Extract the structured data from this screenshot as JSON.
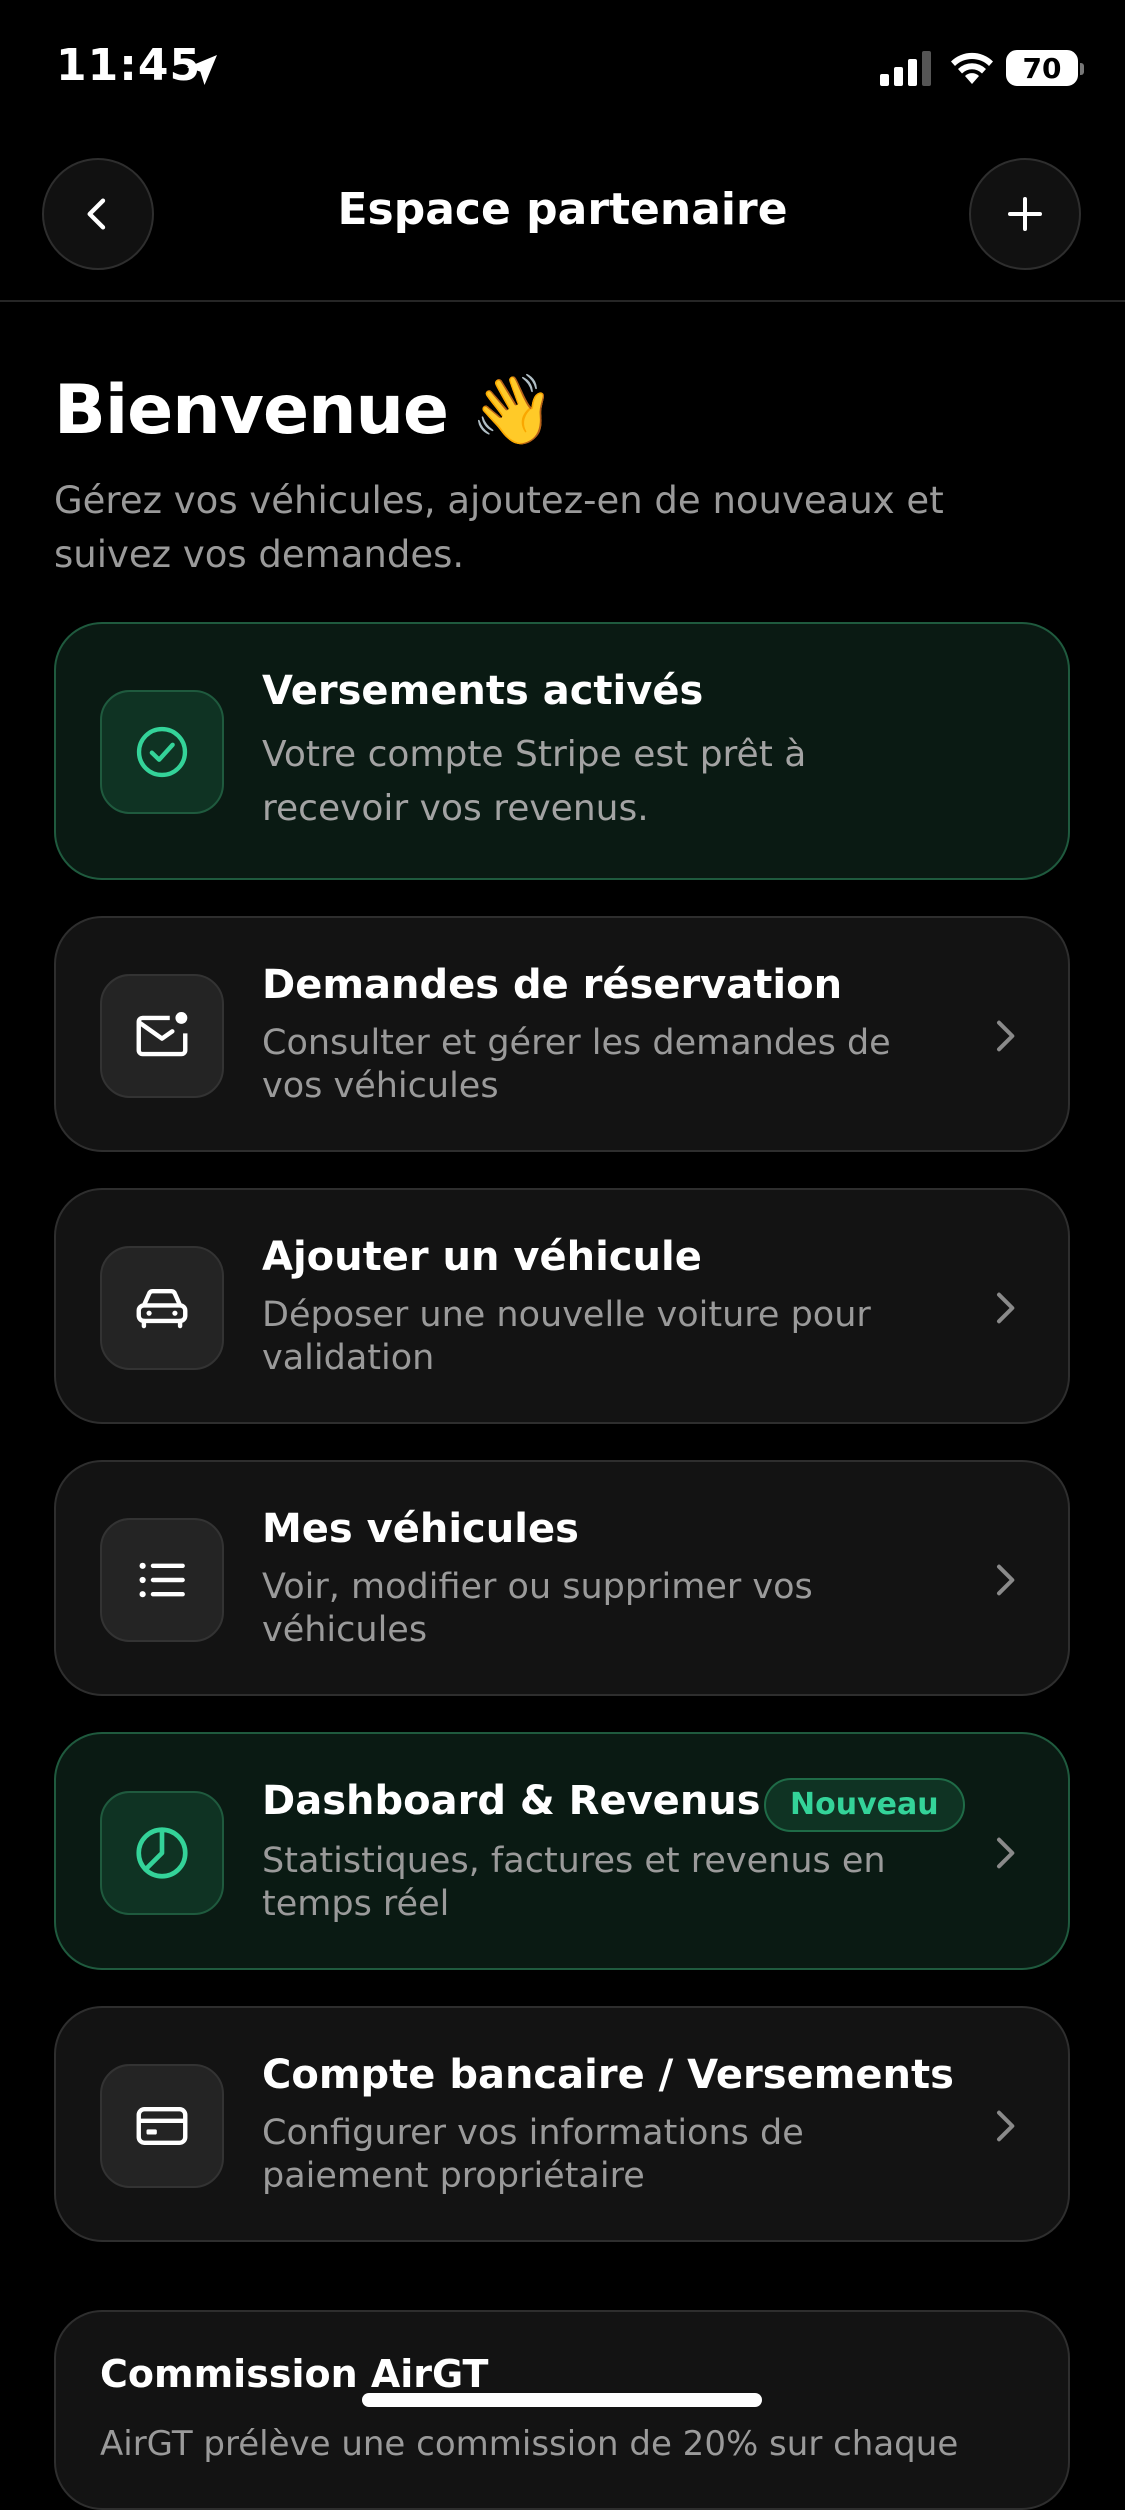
{
  "status_bar": {
    "time": "11:45",
    "battery": "70"
  },
  "header": {
    "title": "Espace partenaire"
  },
  "welcome": {
    "title": "Bienvenue 👋",
    "subtitle": "Gérez vos véhicules, ajoutez-en de nouveaux et suivez vos demandes."
  },
  "cards": [
    {
      "title": "Versements activés",
      "description": "Votre compte Stripe est prêt à recevoir vos revenus.",
      "icon": "check-circle-icon"
    },
    {
      "title": "Demandes de réservation",
      "description": "Consulter et gérer les demandes de vos véhicules",
      "icon": "mail-notification-icon"
    },
    {
      "title": "Ajouter un véhicule",
      "description": "Déposer une nouvelle voiture pour validation",
      "icon": "car-icon"
    },
    {
      "title": "Mes véhicules",
      "description": "Voir, modifier ou supprimer vos véhicules",
      "icon": "list-icon"
    },
    {
      "title": "Dashboard & Revenus",
      "badge": "Nouveau",
      "description": "Statistiques, factures et revenus en temps réel",
      "icon": "pie-chart-icon"
    },
    {
      "title": "Compte bancaire / Versements",
      "description": "Configurer vos informations de paiement propriétaire",
      "icon": "credit-card-icon"
    }
  ],
  "commission": {
    "title": "Commission AirGT",
    "text": "AirGT prélève une commission de 20% sur chaque"
  },
  "colors": {
    "background": "#000000",
    "card": "#131313",
    "accent_green": "#34d399",
    "muted_text": "#9a9a9a"
  }
}
